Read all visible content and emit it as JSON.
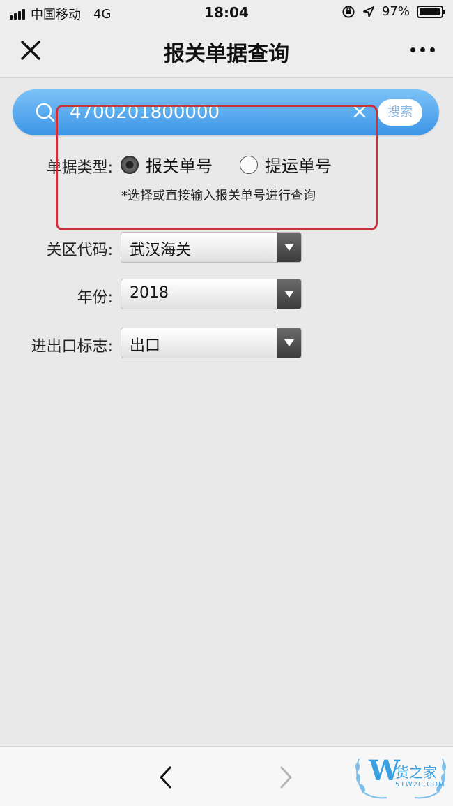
{
  "status_bar": {
    "carrier": "中国移动",
    "network": "4G",
    "time": "18:04",
    "battery": "97%",
    "battery_level": 0.97
  },
  "nav": {
    "title": "报关单据查询",
    "close_icon": "close-icon",
    "more_icon": "more-icon"
  },
  "search": {
    "value": "4700201800000",
    "button_label": "搜索"
  },
  "form": {
    "doc_type_label": "单据类型:",
    "doc_type_options": [
      {
        "label": "报关单号",
        "selected": true
      },
      {
        "label": "提运单号",
        "selected": false
      }
    ],
    "hint": "*选择或直接输入报关单号进行查询",
    "customs_label": "关区代码:",
    "customs_value": "武汉海关",
    "year_label": "年份:",
    "year_value": "2018",
    "ie_label": "进出口标志:",
    "ie_value": "出口"
  },
  "watermark": {
    "logo_letter": "W",
    "text": "货之家",
    "url": "51W2C.COM"
  },
  "colors": {
    "search_gradient_top": "#7cc2f8",
    "search_gradient_bottom": "#3c95e6",
    "highlight": "#c8323c"
  }
}
